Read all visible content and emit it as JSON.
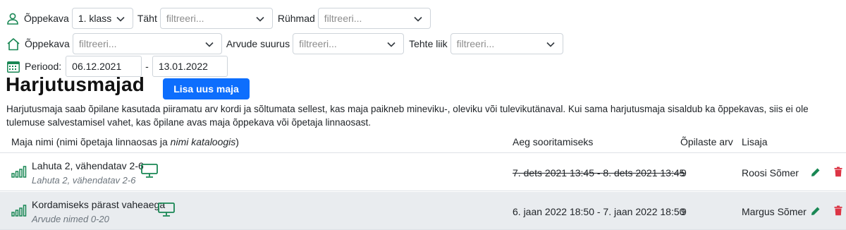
{
  "filters_row1": {
    "curriculum_label": "Õppekava",
    "curriculum_value": "1. klass",
    "letter_label": "Täht",
    "letter_placeholder": "filtreeri...",
    "groups_label": "Rühmad",
    "groups_placeholder": "filtreeri..."
  },
  "filters_row2": {
    "curriculum_label": "Õppekava",
    "curriculum_placeholder": "filtreeri...",
    "number_size_label": "Arvude suurus",
    "number_size_placeholder": "filtreeri...",
    "operation_type_label": "Tehte liik",
    "operation_type_placeholder": "filtreeri..."
  },
  "period": {
    "label": "Periood:",
    "start": "06.12.2021",
    "separator": "-",
    "end": "13.01.2022"
  },
  "page_title": "Harjutusmajad",
  "add_button_label": "Lisa uus maja",
  "description": "Harjutusmaja saab õpilane kasutada piiramatu arv kordi ja sõltumata sellest, kas maja paikneb mineviku-, oleviku või tulevikutänaval. Kui sama harjutusmaja sisaldub ka õppekavas, siis ei ole tulemuse salvestamisel vahet, kas õpilane avas maja õppekava või õpetaja linnaosast.",
  "table": {
    "headers": {
      "name_prefix": "Maja nimi (nimi õpetaja linnaosas ja ",
      "name_italic": "nimi kataloogis",
      "name_suffix": ")",
      "time": "Aeg sooritamiseks",
      "students": "Õpilaste arv",
      "added_by": "Lisaja"
    },
    "rows": [
      {
        "name": "Lahuta 2, vähendatav 2-6",
        "catalog_name": "Lahuta 2, vähendatav 2-6",
        "time": "7. dets 2021 13:45 - 8. dets 2021 13:45",
        "time_expired": true,
        "students": "9",
        "added_by": "Roosi Sõmer"
      },
      {
        "name": "Kordamiseks pärast vaheaega",
        "catalog_name": "Arvude nimed 0-20",
        "time": "6. jaan 2022 18:50 - 7. jaan 2022 18:50",
        "time_expired": false,
        "students": "9",
        "added_by": "Margus Sõmer"
      }
    ]
  },
  "colors": {
    "accent_green": "#198754",
    "primary_blue": "#0d6efd",
    "danger_red": "#dc3545",
    "row_alt_bg": "#e9ecef"
  }
}
